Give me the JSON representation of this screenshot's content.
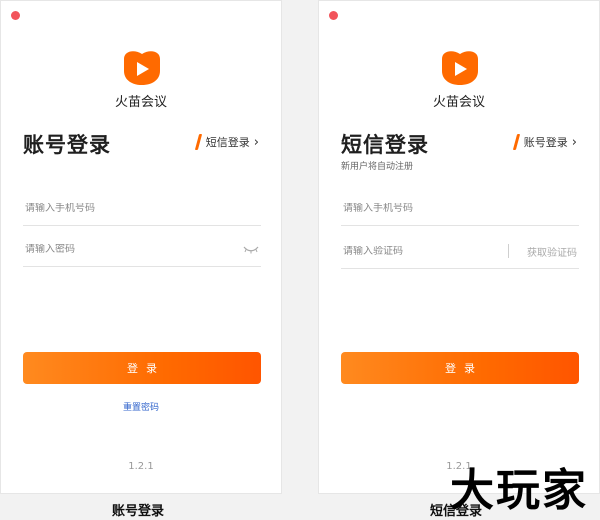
{
  "colors": {
    "accent": "#ff6a00",
    "link": "#3366cc",
    "close": "#f2545b"
  },
  "brand": {
    "name": "火苗会议"
  },
  "account_panel": {
    "title": "账号登录",
    "switch_label": "短信登录",
    "phone_placeholder": "请输入手机号码",
    "password_placeholder": "请输入密码",
    "login_label": "登录",
    "reset_label": "重置密码",
    "version": "1.2.1",
    "caption": "账号登录"
  },
  "sms_panel": {
    "title": "短信登录",
    "switch_label": "账号登录",
    "subtitle": "新用户将自动注册",
    "phone_placeholder": "请输入手机号码",
    "code_placeholder": "请输入验证码",
    "get_code_label": "获取验证码",
    "login_label": "登录",
    "version": "1.2.1",
    "caption": "短信登录"
  },
  "watermark": "大玩家"
}
